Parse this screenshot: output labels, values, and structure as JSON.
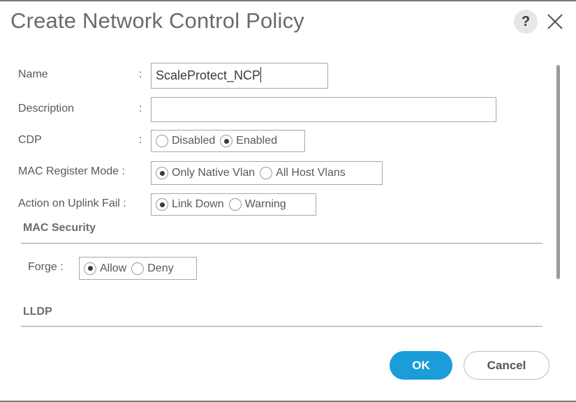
{
  "dialog": {
    "title": "Create Network Control Policy",
    "help_label": "?",
    "close_icon": "close-icon"
  },
  "form": {
    "separator": ":",
    "name": {
      "label": "Name",
      "value": "ScaleProtect_NCP"
    },
    "description": {
      "label": "Description",
      "value": ""
    },
    "cdp": {
      "label": "CDP",
      "options": [
        {
          "label": "Disabled",
          "selected": false
        },
        {
          "label": "Enabled",
          "selected": true
        }
      ]
    },
    "mac_register_mode": {
      "label": "MAC Register Mode :",
      "options": [
        {
          "label": "Only Native Vlan",
          "selected": true
        },
        {
          "label": "All Host Vlans",
          "selected": false
        }
      ]
    },
    "action_on_uplink_fail": {
      "label": "Action on Uplink Fail :",
      "options": [
        {
          "label": "Link Down",
          "selected": true
        },
        {
          "label": "Warning",
          "selected": false
        }
      ]
    }
  },
  "mac_security": {
    "title": "MAC Security",
    "forge": {
      "label": "Forge :",
      "options": [
        {
          "label": "Allow",
          "selected": true
        },
        {
          "label": "Deny",
          "selected": false
        }
      ]
    }
  },
  "lldp": {
    "title": "LLDP"
  },
  "buttons": {
    "ok": "OK",
    "cancel": "Cancel"
  },
  "colors": {
    "primary": "#1b9dd9",
    "text": "#58585b"
  }
}
